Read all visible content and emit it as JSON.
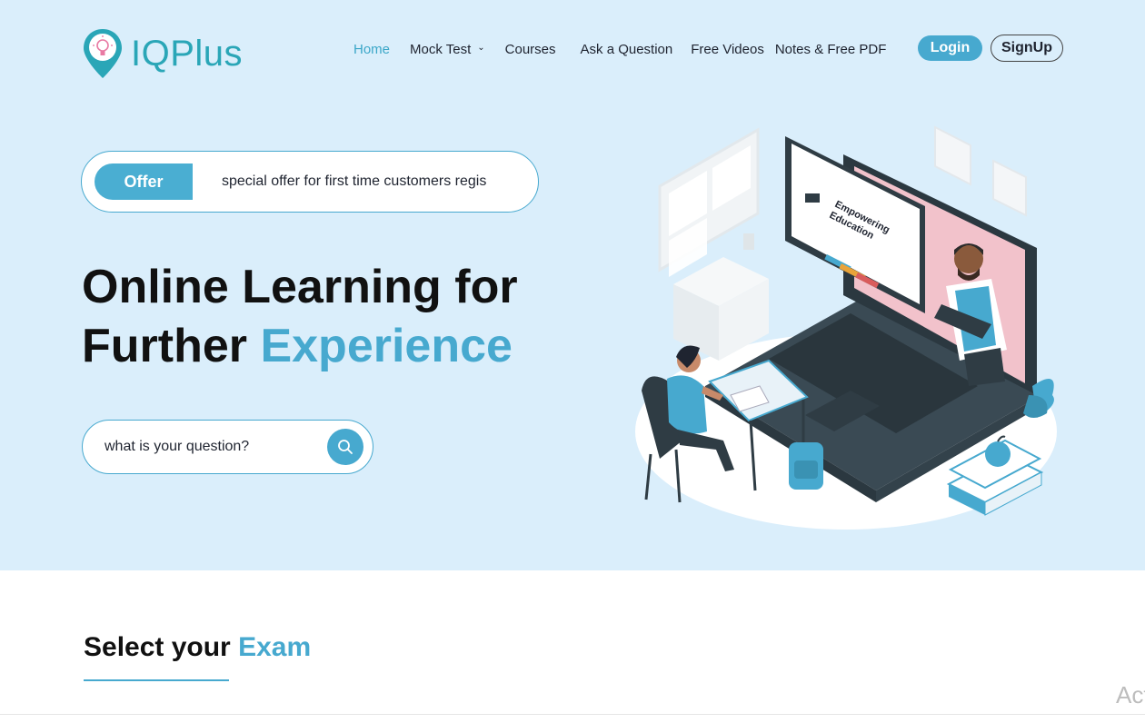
{
  "brand": {
    "name": "IQPlus",
    "color": "#2aa6b7"
  },
  "nav": {
    "items": [
      {
        "label": "Home",
        "active": true
      },
      {
        "label": "Mock Test",
        "has_dropdown": true
      },
      {
        "label": "Courses"
      },
      {
        "label": "Ask a Question"
      },
      {
        "label": "Free Videos"
      },
      {
        "label": "Notes & Free PDF"
      }
    ],
    "login_label": "Login",
    "signup_label": "SignUp"
  },
  "offer": {
    "badge": "Offer",
    "text": "special offer for first time customers regis"
  },
  "hero": {
    "title_line1": "Online Learning for",
    "title_line2_plain": "Further ",
    "title_line2_accent": "Experience",
    "search_placeholder": "what is your question?",
    "illustration_text_1": "Empowering",
    "illustration_text_2": "Education"
  },
  "section": {
    "title_plain": "Select your ",
    "title_accent": "Exam"
  },
  "watermark": "Act",
  "colors": {
    "accent": "#47a9cf",
    "hero_bg": "#daeefb",
    "laptop": "#3a4a54"
  }
}
